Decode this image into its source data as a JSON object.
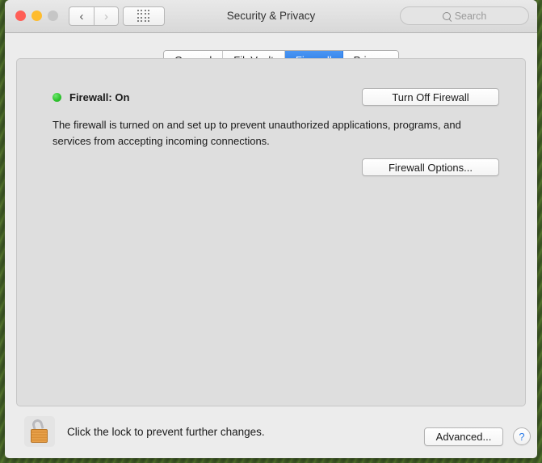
{
  "window": {
    "title": "Security & Privacy",
    "traffic_lights": [
      {
        "name": "close",
        "color": "#ff5f57"
      },
      {
        "name": "minimize",
        "color": "#febc2e"
      },
      {
        "name": "zoom",
        "color": "#c6c6c6"
      }
    ],
    "nav": {
      "back_icon": "‹",
      "forward_icon": "›",
      "grid_icon": "grid-dots-icon"
    },
    "search": {
      "placeholder": "Search",
      "icon": "search-icon"
    }
  },
  "tabs": [
    {
      "label": "General",
      "selected": false
    },
    {
      "label": "FileVault",
      "selected": false
    },
    {
      "label": "Firewall",
      "selected": true
    },
    {
      "label": "Privacy",
      "selected": false
    }
  ],
  "firewall": {
    "status_label": "Firewall: On",
    "status_color": "#2fc52f",
    "description": "The firewall is turned on and set up to prevent unauthorized applications, programs, and services from accepting incoming connections.",
    "turn_off_button": "Turn Off Firewall",
    "options_button": "Firewall Options..."
  },
  "footer": {
    "lock_icon": "unlocked-padlock-icon",
    "lock_message": "Click the lock to prevent further changes.",
    "advanced_button": "Advanced...",
    "help_button": "?"
  },
  "colors": {
    "accent_blue": "#2a7ae8",
    "window_background": "#ececec",
    "panel_background": "#dedede",
    "titlebar_background": "#e0e0e0"
  }
}
